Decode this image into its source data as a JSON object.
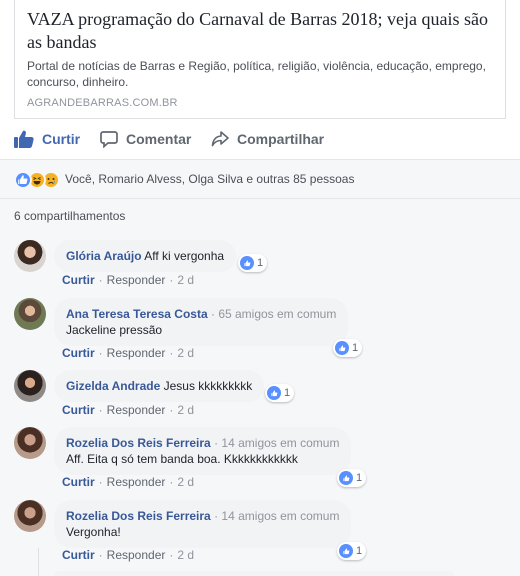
{
  "link_preview": {
    "title": "VAZA programação do Carnaval de Barras 2018; veja quais são as bandas",
    "description": "Portal de notícias de Barras e Região, política, religião, violência, educação, emprego, concurso, dinheiro.",
    "domain": "AGRANDEBARRAS.COM.BR"
  },
  "actions": {
    "like": "Curtir",
    "comment": "Comentar",
    "share": "Compartilhar"
  },
  "reactions": {
    "icons": [
      "like-icon",
      "haha-icon",
      "sad-icon"
    ],
    "text": "Você, Romario Alvess, Olga Silva e outras 85 pessoas"
  },
  "shares": {
    "text": "6 compartilhamentos"
  },
  "comment_actions": {
    "like": "Curtir",
    "reply": "Responder"
  },
  "comments": [
    {
      "author": "Glória Araújo",
      "mutual": "",
      "text": "Aff ki vergonha",
      "time": "2 d",
      "likes": "1"
    },
    {
      "author": "Ana Teresa Teresa Costa",
      "mutual": "65 amigos em comum",
      "text": "Jackeline pressão",
      "time": "2 d",
      "likes": "1"
    },
    {
      "author": "Gizelda Andrade",
      "mutual": "",
      "text": "Jesus kkkkkkkkk",
      "time": "2 d",
      "likes": "1"
    },
    {
      "author": "Rozelia Dos Reis Ferreira",
      "mutual": "14 amigos em comum",
      "text": "Aff. Eita q só tem banda boa. Kkkkkkkkkkkk",
      "time": "2 d",
      "likes": "1"
    },
    {
      "author": "Rozelia Dos Reis Ferreira",
      "mutual": "14 amigos em comum",
      "text": "Vergonha!",
      "time": "2 d",
      "likes": "1"
    }
  ],
  "colors": {
    "accent": "#4267b2",
    "link": "#385898",
    "like_blue": "#5890ff",
    "reaction_yellow": "#f7b125"
  }
}
